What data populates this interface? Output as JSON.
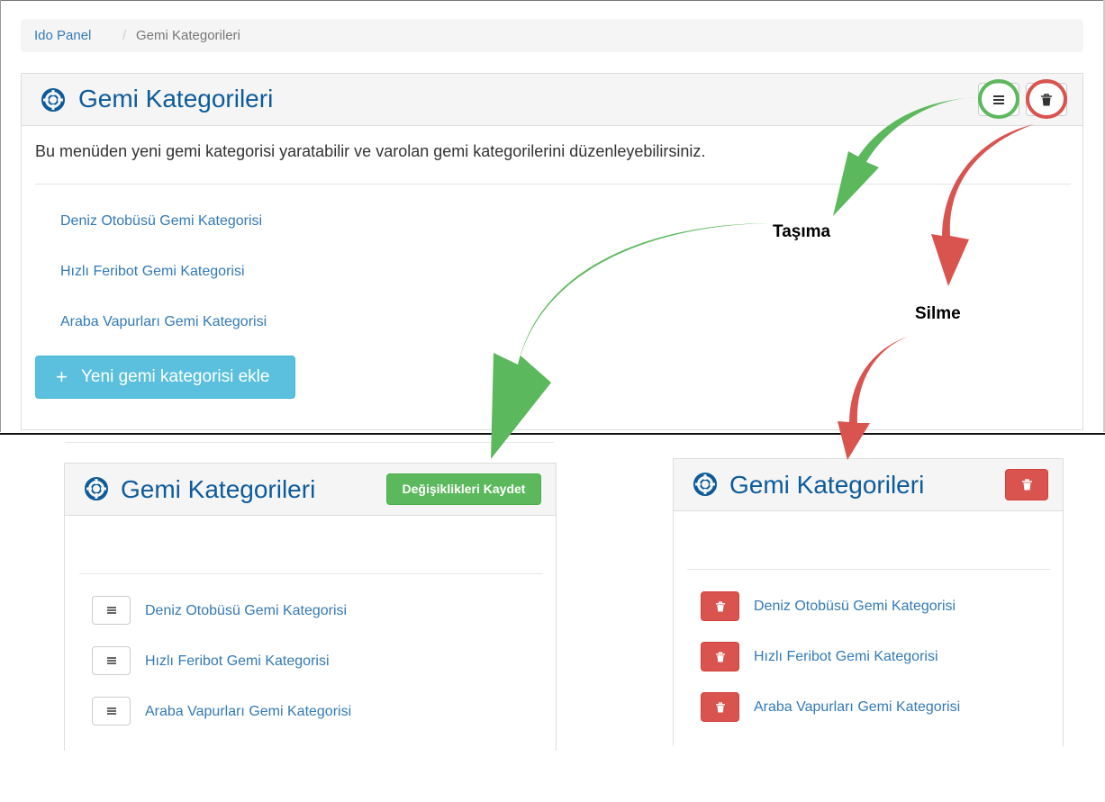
{
  "breadcrumb": {
    "home": "Ido Panel",
    "separator": "/",
    "current": "Gemi Kategorileri"
  },
  "main_panel": {
    "title": "Gemi Kategorileri",
    "description": "Bu menüden yeni gemi kategorisi yaratabilir ve varolan gemi kategorilerini düzenleyebilirsiniz.",
    "categories": [
      "Deniz Otobüsü Gemi Kategorisi",
      "Hızlı Feribot Gemi Kategorisi",
      "Araba Vapurları Gemi Kategorisi"
    ],
    "add_button": {
      "icon": "+",
      "label": "Yeni gemi kategorisi ekle"
    },
    "header_buttons": [
      "reorder-icon",
      "trash-icon"
    ]
  },
  "annotations": {
    "move_label": "Taşıma",
    "delete_label": "Silme",
    "move_color": "#5cb85c",
    "delete_color": "#d9534f"
  },
  "move_panel": {
    "title": "Gemi Kategorileri",
    "save_button": "Değişiklikleri Kaydet",
    "categories": [
      "Deniz Otobüsü Gemi Kategorisi",
      "Hızlı Feribot Gemi Kategorisi",
      "Araba Vapurları Gemi Kategorisi"
    ]
  },
  "delete_panel": {
    "title": "Gemi Kategorileri",
    "categories": [
      "Deniz Otobüsü Gemi Kategorisi",
      "Hızlı Feribot Gemi Kategorisi",
      "Araba Vapurları Gemi Kategorisi"
    ]
  },
  "colors": {
    "title_blue": "#0e5b9b",
    "link_blue": "#337ab7",
    "info": "#5bc0de",
    "success": "#5cb85c",
    "danger": "#d9534f"
  }
}
